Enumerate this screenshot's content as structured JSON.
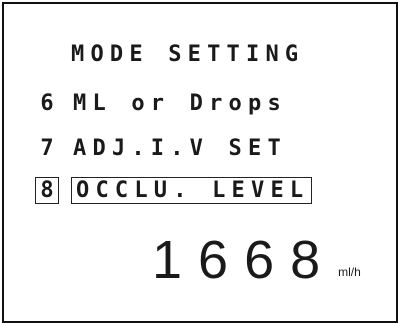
{
  "screen": {
    "title": "MODE SETTING",
    "menu_items": [
      {
        "number": "6",
        "label": "ML or Drops",
        "selected": false
      },
      {
        "number": "7",
        "label": "ADJ.I.V SET",
        "selected": false
      },
      {
        "number": "8",
        "label": "OCCLU. LEVEL",
        "selected": true
      }
    ],
    "readout": {
      "value": "1668",
      "unit": "ml/h"
    }
  }
}
